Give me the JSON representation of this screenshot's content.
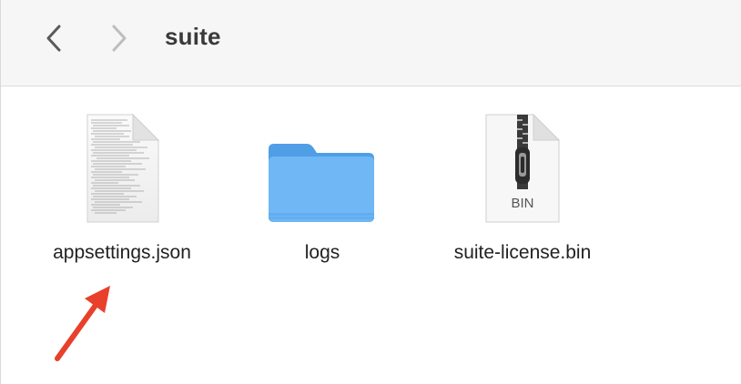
{
  "toolbar": {
    "title": "suite",
    "back_icon": "chevron-left-icon",
    "forward_icon": "chevron-right-icon"
  },
  "files": [
    {
      "name": "appsettings.json",
      "icon": "text-document-icon"
    },
    {
      "name": "logs",
      "icon": "folder-icon"
    },
    {
      "name": "suite-license.bin",
      "icon": "zip-archive-icon",
      "badge": "BIN"
    }
  ],
  "annotation": {
    "icon": "pointer-arrow-icon",
    "color": "#e8402a"
  },
  "colors": {
    "folder": "#6fb7f5",
    "folder_tab": "#4f9ee6",
    "toolbar_bg": "#f6f6f6"
  }
}
